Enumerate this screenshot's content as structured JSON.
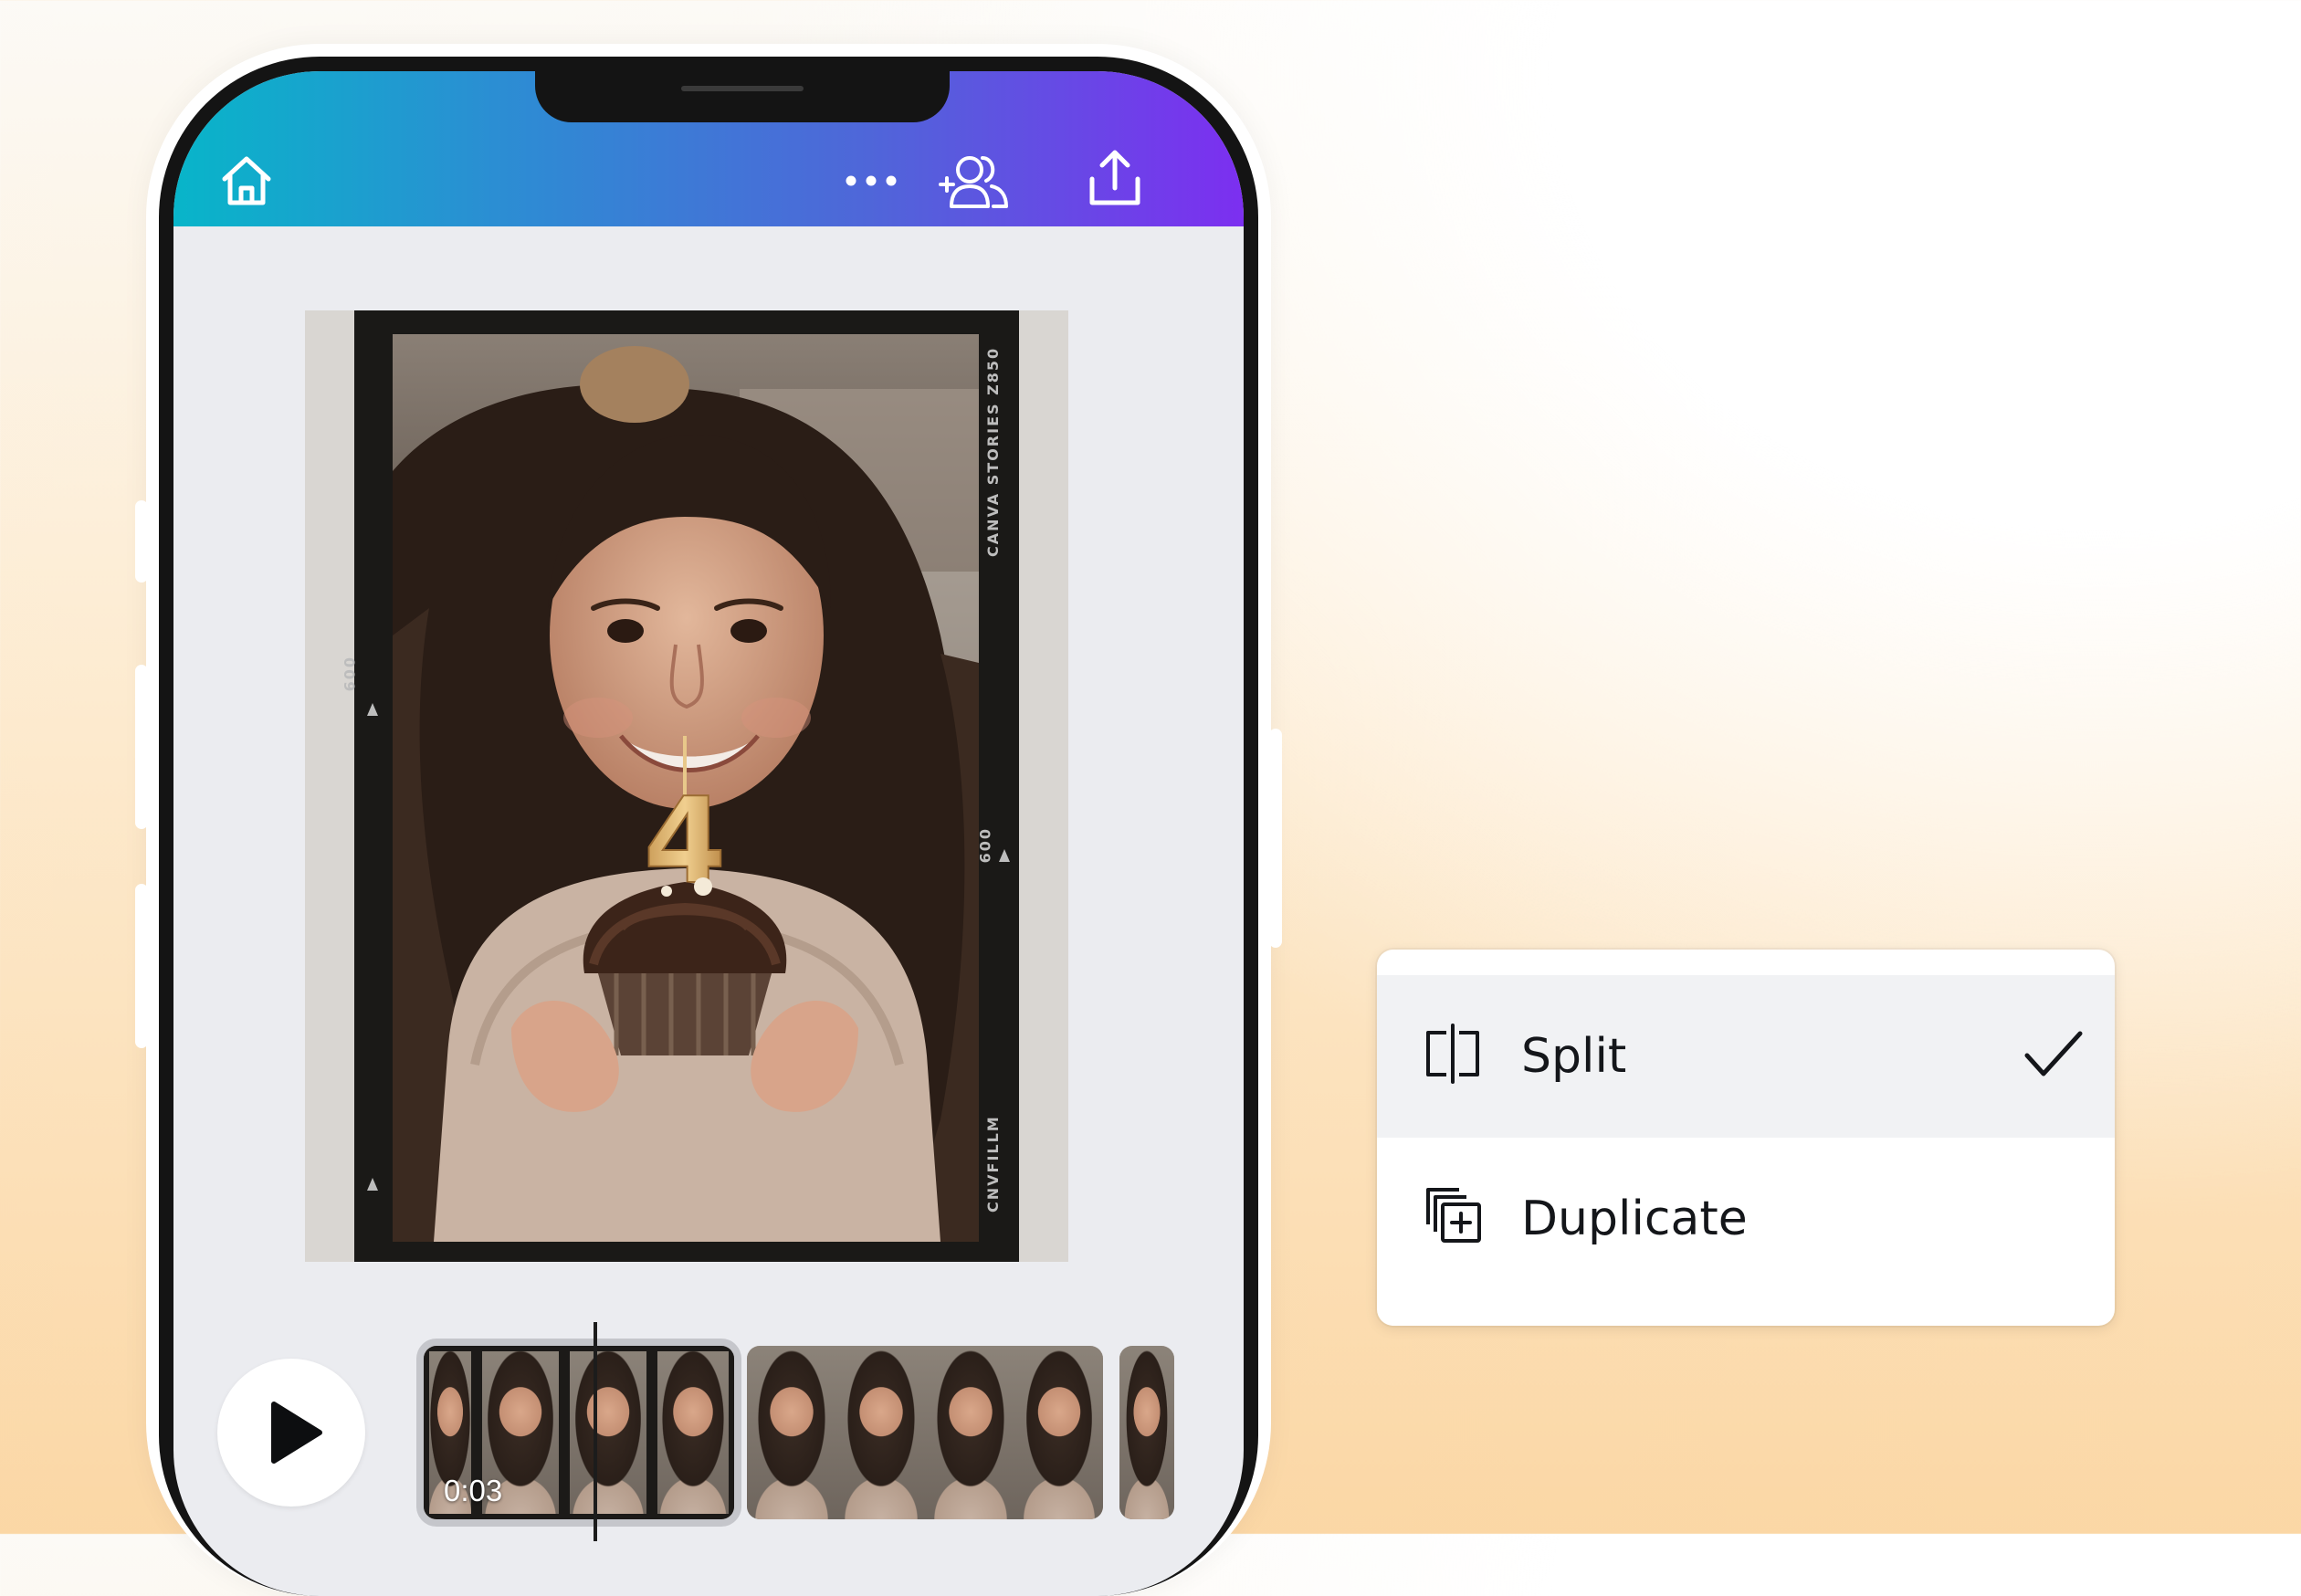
{
  "app_bar": {
    "icons": [
      "home-icon",
      "more-options-icon",
      "add-collaborator-icon",
      "share-upload-icon"
    ],
    "gradient": [
      "#08b5c9",
      "#7c2ff0"
    ]
  },
  "canvas": {
    "film_side_text": "CANVA STORIES Z850",
    "film_frame_number_left": "009",
    "film_frame_number_right": "009",
    "film_brand_text": "CNVFILLM",
    "candle_number": "4"
  },
  "timeline": {
    "current_time": "0:03",
    "play_icon": "play-icon"
  },
  "context_menu": {
    "items": [
      {
        "label": "Split",
        "icon": "split-icon",
        "checked": true
      },
      {
        "label": "Duplicate",
        "icon": "duplicate-icon",
        "checked": false
      }
    ]
  },
  "colors": {
    "menu_selected_bg": "#f1f2f4",
    "screen_bg": "#ebecf0",
    "text_dark": "#14161a"
  }
}
